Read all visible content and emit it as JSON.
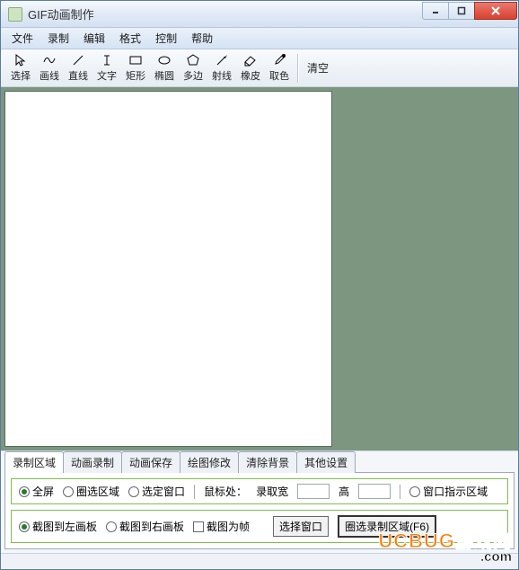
{
  "window": {
    "title": "GIF动画制作"
  },
  "menu": {
    "items": [
      "文件",
      "录制",
      "编辑",
      "格式",
      "控制",
      "帮助"
    ]
  },
  "tools": [
    {
      "icon": "cursor",
      "label": "选择"
    },
    {
      "icon": "squiggle",
      "label": "画线"
    },
    {
      "icon": "line",
      "label": "直线"
    },
    {
      "icon": "ibeam",
      "label": "文字"
    },
    {
      "icon": "rect",
      "label": "矩形"
    },
    {
      "icon": "ellipse",
      "label": "椭圆"
    },
    {
      "icon": "polygon",
      "label": "多边"
    },
    {
      "icon": "ray",
      "label": "射线"
    },
    {
      "icon": "eraser",
      "label": "橡皮"
    },
    {
      "icon": "dropper",
      "label": "取色"
    }
  ],
  "clear_label": "清空",
  "tabs": [
    "录制区域",
    "动画录制",
    "动画保存",
    "绘图修改",
    "清除背景",
    "其他设置"
  ],
  "active_tab": 0,
  "row1": {
    "opt_fullscreen": "全屏",
    "opt_boxselect": "圈选区域",
    "opt_pickwindow": "选定窗口",
    "mouse_label": "鼠标处：",
    "rec_width_label": "录取宽",
    "rec_height_label": "高",
    "opt_indicator": "窗口指示区域",
    "width_value": "",
    "height_value": ""
  },
  "row2": {
    "opt_left": "截图到左画板",
    "opt_right": "截图到右画板",
    "chk_asframe": "截图为帧",
    "btn_pickwin": "选择窗口",
    "btn_boxrec": "圈选录制区域(F6)"
  },
  "watermark": {
    "line1a": "UCBUG",
    "line1b": "游戏网",
    "line2": ".com"
  }
}
